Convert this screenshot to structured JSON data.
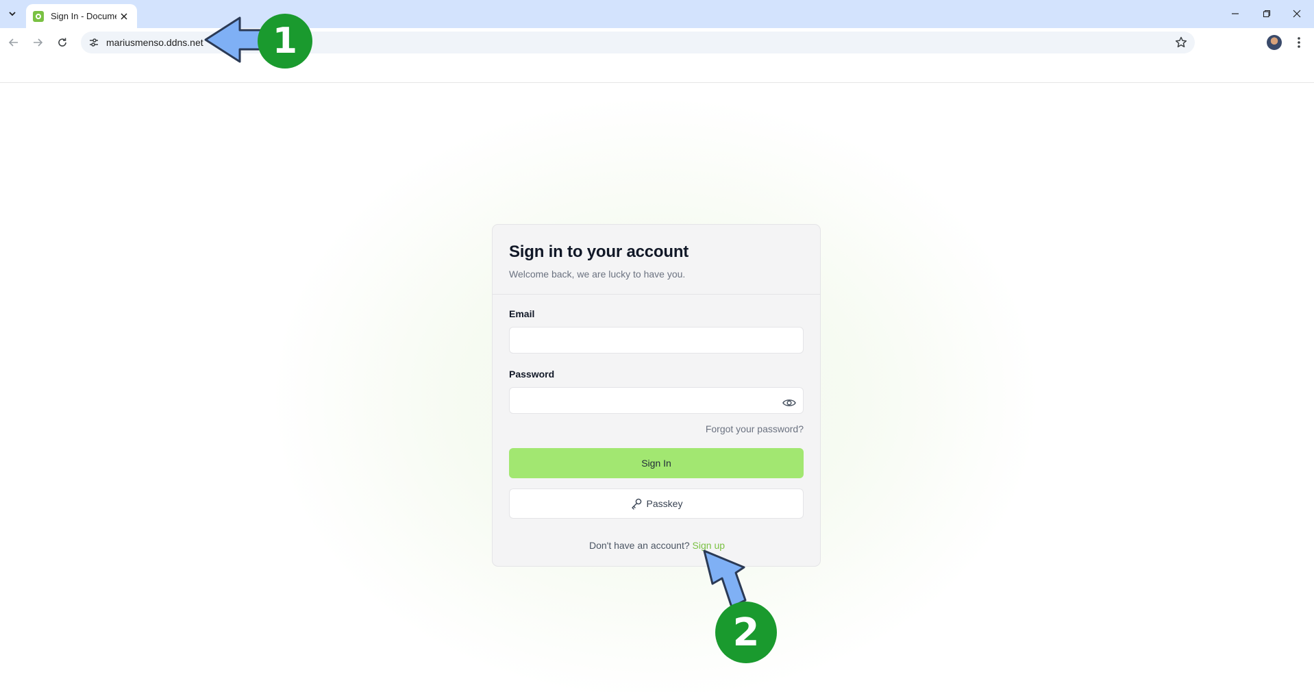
{
  "browser": {
    "tab_title": "Sign In - Documenso",
    "url": "mariusmenso.ddns.net"
  },
  "card": {
    "title": "Sign in to your account",
    "subtitle": "Welcome back, we are lucky to have you.",
    "email_label": "Email",
    "email_value": "",
    "password_label": "Password",
    "password_value": "",
    "forgot_link": "Forgot your password?",
    "signin_button": "Sign In",
    "passkey_button": "Passkey",
    "signup_prompt": "Don't have an account?",
    "signup_link": "Sign up"
  },
  "annotations": {
    "step1": "1",
    "step2": "2"
  },
  "colors": {
    "accent_green": "#a2e771",
    "link_green": "#7ac143",
    "badge_green": "#1a9a2e",
    "arrow_blue": "#7fb0f5",
    "tabstrip": "#d3e3fd"
  },
  "icons": {
    "tab_search": "chevron-down-icon",
    "favicon": "documenso-logo-icon",
    "tab_close": "close-icon",
    "back": "arrow-left-icon",
    "forward": "arrow-right-icon",
    "reload": "reload-icon",
    "site_settings": "tune-icon",
    "bookmark": "star-icon",
    "menu": "more-vert-icon",
    "password_toggle": "eye-icon",
    "passkey": "key-icon"
  }
}
